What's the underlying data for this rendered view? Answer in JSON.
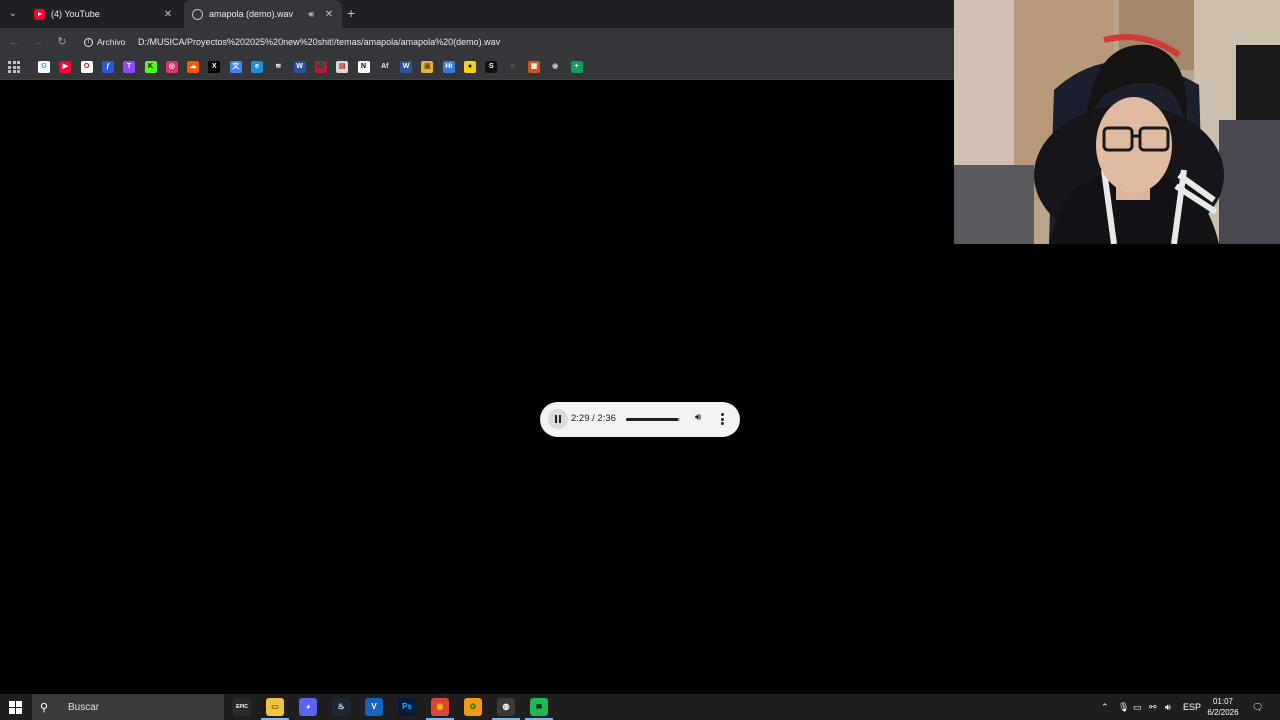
{
  "browser": {
    "tabs": [
      {
        "title": "(4) YouTube",
        "icon": "youtube-favicon"
      },
      {
        "title": "amapola (demo).wav",
        "icon": "globe-favicon",
        "playing_audio": true
      }
    ],
    "security_label": "Archivo",
    "url": "D:/MUSICA/Proyectos%202025%20new%20shit!/temas/amapola/amapola%20(demo).wav",
    "bookmarks": [
      {
        "name": "google",
        "color": "#ffffff",
        "glyph": "G",
        "fg": "#4285f4"
      },
      {
        "name": "youtube",
        "color": "#ff0033",
        "glyph": "▶",
        "fg": "#ffffff"
      },
      {
        "name": "opera",
        "color": "#ffffff",
        "glyph": "O",
        "fg": "#cc0f16"
      },
      {
        "name": "feather",
        "color": "#2a5bd7",
        "glyph": "ƒ",
        "fg": "#ffffff"
      },
      {
        "name": "twitch",
        "color": "#9146ff",
        "glyph": "T",
        "fg": "#ffffff"
      },
      {
        "name": "kick",
        "color": "#53fc18",
        "glyph": "K",
        "fg": "#000000"
      },
      {
        "name": "instagram",
        "color": "#e1306c",
        "glyph": "◎",
        "fg": "#ffffff"
      },
      {
        "name": "soundcloud",
        "color": "#ff5500",
        "glyph": "☁",
        "fg": "#ffffff"
      },
      {
        "name": "x",
        "color": "#000000",
        "glyph": "X",
        "fg": "#ffffff"
      },
      {
        "name": "translate",
        "color": "#4285f4",
        "glyph": "文",
        "fg": "#ffffff"
      },
      {
        "name": "edge",
        "color": "#1e8fd6",
        "glyph": "e",
        "fg": "#ffffff"
      },
      {
        "name": "stack",
        "color": "#35363a",
        "glyph": "≋",
        "fg": "#ffffff"
      },
      {
        "name": "word",
        "color": "#2b579a",
        "glyph": "W",
        "fg": "#ffffff"
      },
      {
        "name": "red-app",
        "color": "#c8102e",
        "glyph": "⬛",
        "fg": "#7a0a1b"
      },
      {
        "name": "doc",
        "color": "#d9d9d9",
        "glyph": "▤",
        "fg": "#c62828"
      },
      {
        "name": "notion",
        "color": "#ffffff",
        "glyph": "N",
        "fg": "#000000"
      },
      {
        "name": "ae",
        "color": "#35363a",
        "glyph": "Af",
        "fg": "#e8eaed"
      },
      {
        "name": "word2",
        "color": "#2b579a",
        "glyph": "W",
        "fg": "#ffffff"
      },
      {
        "name": "photos",
        "color": "#e0b341",
        "glyph": "▣",
        "fg": "#7a4c00"
      },
      {
        "name": "hi",
        "color": "#3a7bd5",
        "glyph": "Hi",
        "fg": "#ffffff"
      },
      {
        "name": "yellow-circle",
        "color": "#f7d117",
        "glyph": "●",
        "fg": "#000000"
      },
      {
        "name": "s-app",
        "color": "#111111",
        "glyph": "S",
        "fg": "#ffffff"
      },
      {
        "name": "ring",
        "color": "#35363a",
        "glyph": "○",
        "fg": "#e8a33b"
      },
      {
        "name": "orange",
        "color": "#d9501f",
        "glyph": "▦",
        "fg": "#ffffff"
      },
      {
        "name": "podcast",
        "color": "#35363a",
        "glyph": "◉",
        "fg": "#bdc1c6"
      },
      {
        "name": "sheets",
        "color": "#0f9d58",
        "glyph": "+",
        "fg": "#ffffff"
      }
    ]
  },
  "audio_player": {
    "time_display": "2:29 / 2:36",
    "progress": 0.955,
    "state": "playing"
  },
  "taskbar": {
    "search_placeholder": "Buscar",
    "apps": [
      {
        "name": "epic-games",
        "glyph": "EPIC",
        "color": "#2a2a2a",
        "fg": "#ffffff"
      },
      {
        "name": "file-explorer",
        "glyph": "▭",
        "color": "#f0c541",
        "fg": "#7a5a00",
        "active": true
      },
      {
        "name": "discord",
        "glyph": "◕",
        "color": "#5865f2",
        "fg": "#ffffff"
      },
      {
        "name": "steam",
        "glyph": "♨",
        "color": "#1b2838",
        "fg": "#ffffff"
      },
      {
        "name": "vegas",
        "glyph": "V",
        "color": "#1565c0",
        "fg": "#ffffff"
      },
      {
        "name": "photoshop",
        "glyph": "Ps",
        "color": "#001e36",
        "fg": "#31a8ff"
      },
      {
        "name": "chrome",
        "glyph": "◉",
        "color": "#db4437",
        "fg": "#fbbc05",
        "active": true
      },
      {
        "name": "fl-studio",
        "glyph": "✿",
        "color": "#f39c12",
        "fg": "#2e7d32"
      },
      {
        "name": "obs",
        "glyph": "◍",
        "color": "#3a3a3a",
        "fg": "#ffffff",
        "active": true
      },
      {
        "name": "spotify",
        "glyph": "≋",
        "color": "#1db954",
        "fg": "#000000",
        "active": true
      }
    ],
    "language": "ESP",
    "time": "01:07",
    "date": "6/2/2026"
  }
}
